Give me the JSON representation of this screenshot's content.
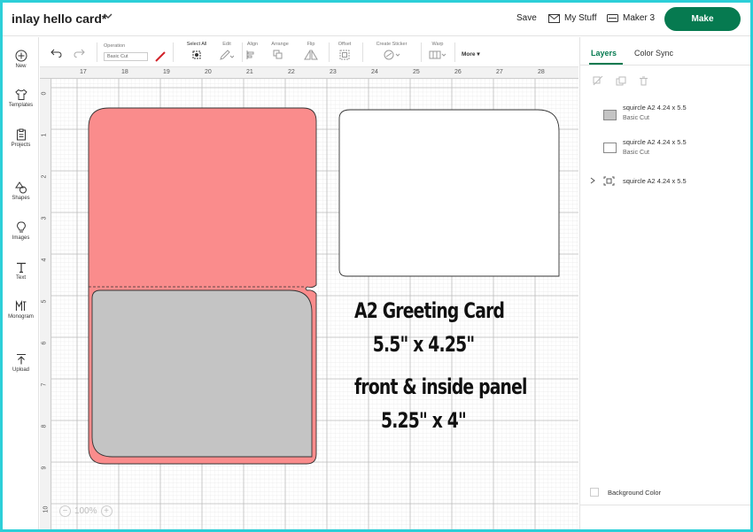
{
  "header": {
    "project_title": "inlay hello card*",
    "save_label": "Save",
    "my_stuff_label": "My Stuff",
    "machine_label": "Maker 3",
    "make_label": "Make",
    "accent_color": "#067a50"
  },
  "sidebar": {
    "items": [
      {
        "label": "New",
        "icon": "plus-icon"
      },
      {
        "label": "Templates",
        "icon": "shirt-icon"
      },
      {
        "label": "Projects",
        "icon": "clipboard-icon"
      },
      {
        "label": "Shapes",
        "icon": "shapes-icon"
      },
      {
        "label": "Images",
        "icon": "lightbulb-icon"
      },
      {
        "label": "Text",
        "icon": "text-icon"
      },
      {
        "label": "Monogram",
        "icon": "monogram-icon"
      },
      {
        "label": "Upload",
        "icon": "upload-icon"
      }
    ]
  },
  "toolbar": {
    "operation_label": "Operation",
    "operation_value": "Basic Cut",
    "select_all_label": "Select All",
    "edit_label": "Edit",
    "align_label": "Align",
    "arrange_label": "Arrange",
    "flip_label": "Flip",
    "offset_label": "Offset",
    "create_sticker_label": "Create Sticker",
    "warp_label": "Warp",
    "more_label": "More"
  },
  "canvas": {
    "ruler_top": [
      "17",
      "18",
      "19",
      "20",
      "21",
      "22",
      "23",
      "24",
      "25",
      "26",
      "27",
      "28"
    ],
    "ruler_left": [
      "0",
      "1",
      "2",
      "3",
      "4",
      "5",
      "6",
      "7",
      "8",
      "9",
      "10"
    ],
    "card_title_line1": "A2 Greeting Card",
    "card_title_line2": "5.5\" x 4.25\"",
    "panel_line1": "front & inside panel",
    "panel_line2": "5.25\" x 4\"",
    "zoom_value": "100%",
    "card_color": "#fa8c8c",
    "inlay_color": "#c4c4c4"
  },
  "panel": {
    "tab_layers": "Layers",
    "tab_color_sync": "Color Sync",
    "layers": [
      {
        "name": "squircle A2 4.24 x 5.5",
        "operation": "Basic Cut",
        "swatch": "#c4c4c4"
      },
      {
        "name": "squircle A2 4.24 x 5.5",
        "operation": "Basic Cut",
        "swatch": "#ffffff"
      },
      {
        "name": "squircle A2 4.24 x 5.5",
        "operation": "",
        "swatch": ""
      }
    ],
    "background_color_label": "Background Color"
  }
}
